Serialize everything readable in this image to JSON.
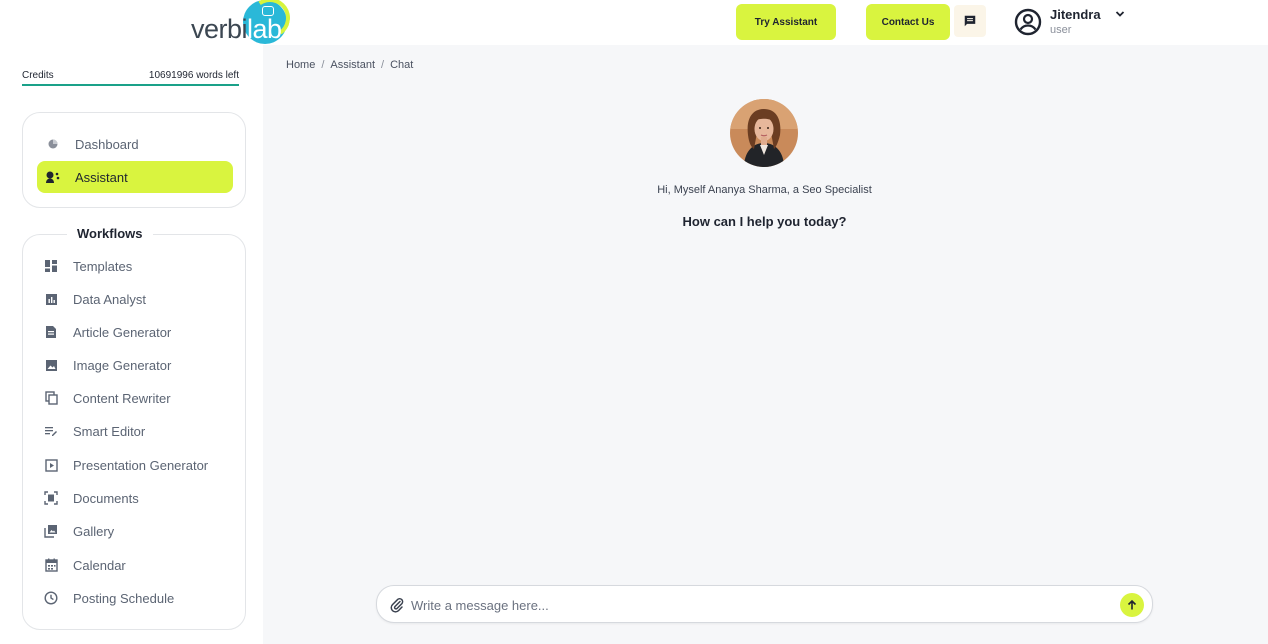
{
  "brand": {
    "logo_text_main": "verbi",
    "logo_text_accent": "lab"
  },
  "header": {
    "try_assistant_label": "Try Assistant",
    "contact_us_label": "Contact Us",
    "user": {
      "name": "Jitendra",
      "role": "user"
    }
  },
  "credits": {
    "label": "Credits",
    "value": "10691996 words left"
  },
  "nav": {
    "items": [
      {
        "label": "Dashboard",
        "icon": "pie-chart-icon",
        "active": false
      },
      {
        "label": "Assistant",
        "icon": "assistant-icon",
        "active": true
      }
    ]
  },
  "workflows": {
    "title": "Workflows",
    "items": [
      {
        "label": "Templates",
        "icon": "dashboard-grid-icon"
      },
      {
        "label": "Data Analyst",
        "icon": "bar-chart-icon"
      },
      {
        "label": "Article Generator",
        "icon": "article-icon"
      },
      {
        "label": "Image Generator",
        "icon": "image-icon"
      },
      {
        "label": "Content Rewriter",
        "icon": "copy-icon"
      },
      {
        "label": "Smart Editor",
        "icon": "edit-note-icon"
      },
      {
        "label": "Presentation Generator",
        "icon": "slideshow-icon"
      },
      {
        "label": "Documents",
        "icon": "document-scan-icon"
      },
      {
        "label": "Gallery",
        "icon": "gallery-icon"
      },
      {
        "label": "Calendar",
        "icon": "calendar-icon"
      },
      {
        "label": "Posting Schedule",
        "icon": "clock-icon"
      }
    ]
  },
  "breadcrumb": {
    "items": [
      "Home",
      "Assistant",
      "Chat"
    ],
    "separator": "/"
  },
  "chat": {
    "greeting": "Hi, Myself Ananya Sharma, a Seo Specialist",
    "prompt": "How can I help you today?",
    "input_placeholder": "Write a message here..."
  },
  "colors": {
    "accent": "#d9f43f",
    "credit_bar": "#1aa189",
    "logo_blue": "#2ab8d8"
  }
}
